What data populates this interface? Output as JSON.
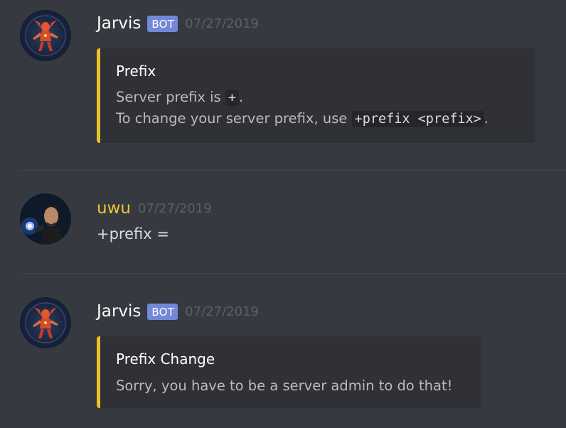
{
  "messages": [
    {
      "author": "Jarvis",
      "author_color": "#ffffff",
      "avatar": "robot-avatar",
      "badge": "BOT",
      "timestamp": "07/27/2019",
      "embed": {
        "accent": "#eac426",
        "title": "Prefix",
        "line1_prefix": "Server prefix is ",
        "line1_code": "+",
        "line1_suffix": ".",
        "line2_prefix": "To change your server prefix, use ",
        "line2_code": "+prefix <prefix>",
        "line2_suffix": "."
      }
    },
    {
      "author": "uwu",
      "author_color": "#f0c634",
      "avatar": "man-avatar",
      "timestamp": "07/27/2019",
      "content": "+prefix ="
    },
    {
      "author": "Jarvis",
      "author_color": "#ffffff",
      "avatar": "robot-avatar",
      "badge": "BOT",
      "timestamp": "07/27/2019",
      "embed": {
        "accent": "#eac426",
        "title": "Prefix Change",
        "description": "Sorry, you have to be a server admin to do that!"
      }
    }
  ]
}
